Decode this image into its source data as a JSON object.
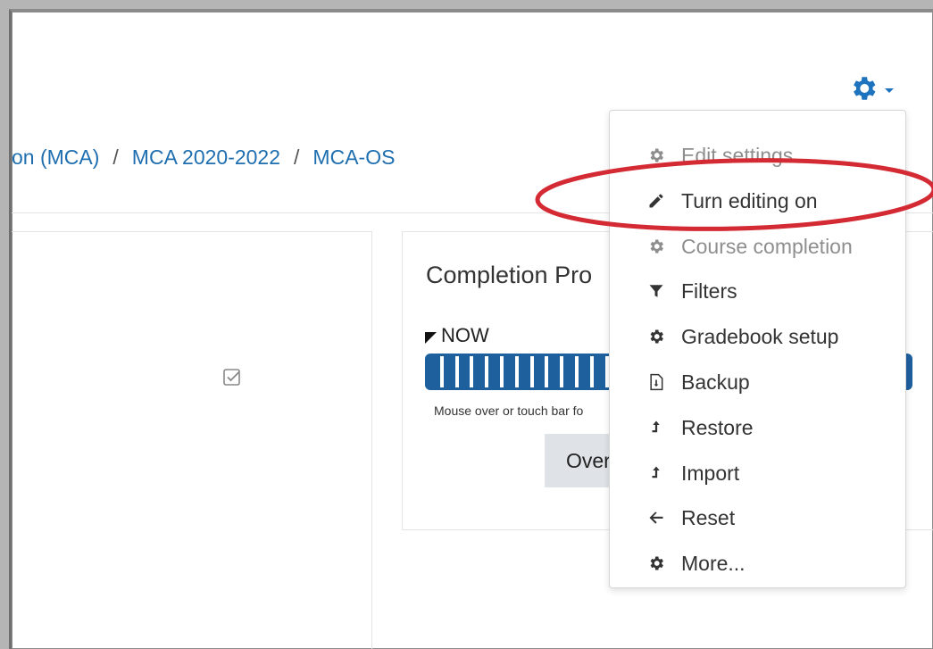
{
  "breadcrumb": {
    "items": [
      "on (MCA)",
      "MCA 2020-2022",
      "MCA-OS"
    ],
    "separator": "/"
  },
  "card": {
    "title": "Completion Pro",
    "now_label": "NOW",
    "hint": "Mouse over or touch bar fo",
    "button_label": "Over"
  },
  "menu": {
    "items": [
      {
        "label": "Edit settings",
        "icon": "gear-icon"
      },
      {
        "label": "Turn editing on",
        "icon": "pencil-icon"
      },
      {
        "label": "Course completion",
        "icon": "gear-icon"
      },
      {
        "label": "Filters",
        "icon": "filter-icon"
      },
      {
        "label": "Gradebook setup",
        "icon": "gear-icon"
      },
      {
        "label": "Backup",
        "icon": "file-icon"
      },
      {
        "label": "Restore",
        "icon": "upload-icon"
      },
      {
        "label": "Import",
        "icon": "upload-icon"
      },
      {
        "label": "Reset",
        "icon": "arrow-left-icon"
      },
      {
        "label": "More...",
        "icon": "gear-icon"
      }
    ]
  },
  "colors": {
    "link": "#1f6fb0",
    "accent": "#1e73be",
    "bar": "#1e5f9e",
    "highlight": "#d42a33"
  }
}
